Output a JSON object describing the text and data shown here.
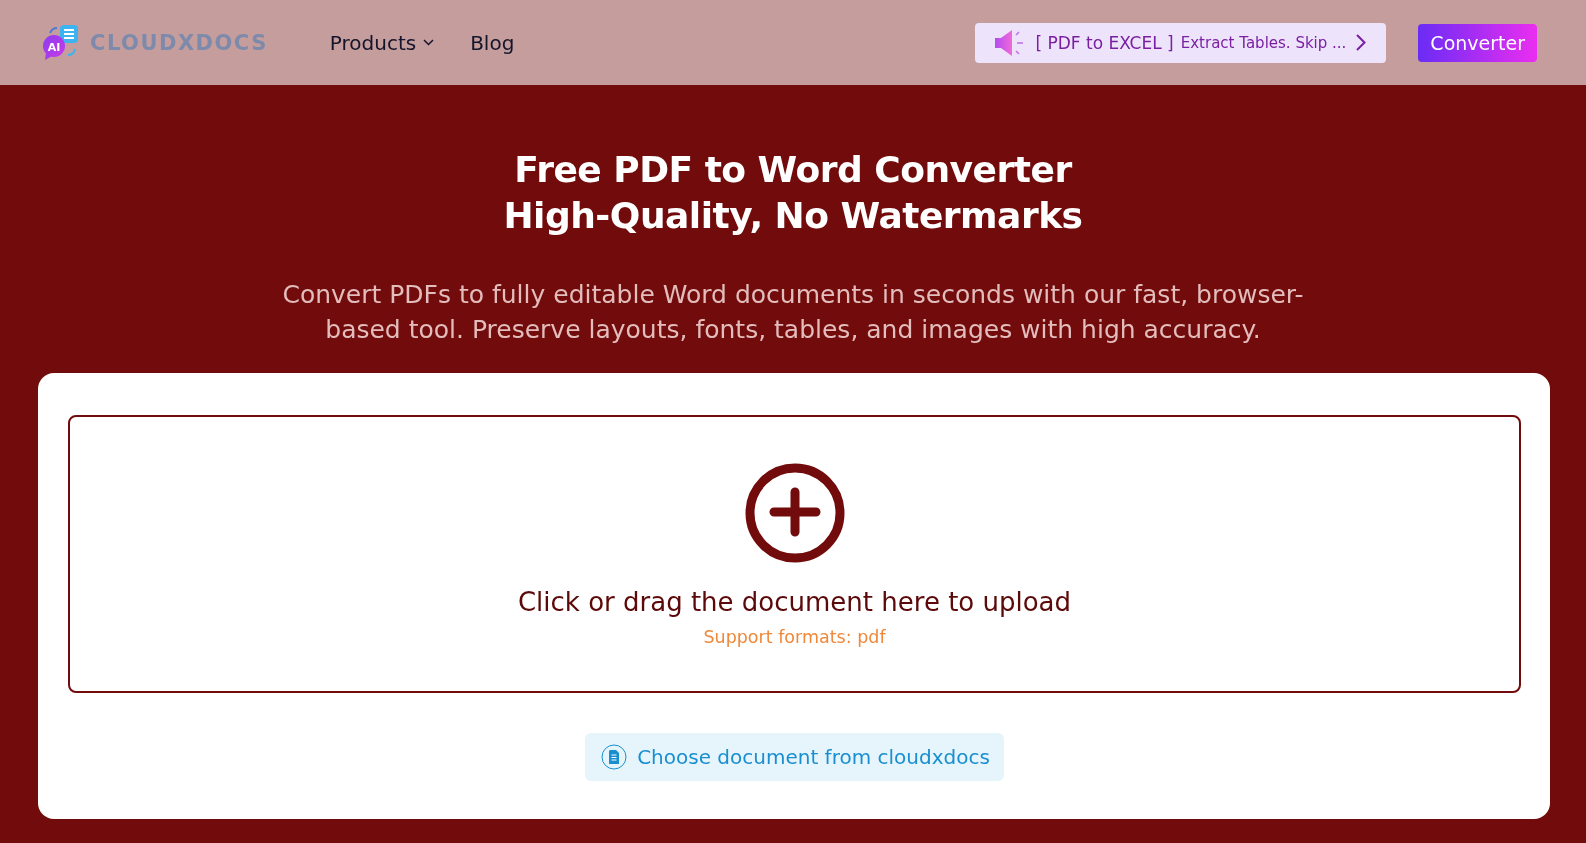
{
  "header": {
    "logo": {
      "badge": "AI",
      "name": "CLOUDXDOCS"
    },
    "nav": [
      {
        "label": "Products",
        "has_dropdown": true
      },
      {
        "label": "Blog",
        "has_dropdown": false
      }
    ],
    "announcement": {
      "tag": "[ PDF to EXCEL ]",
      "text": "Extract Tables. Skip ..."
    },
    "cta": "Converter"
  },
  "hero": {
    "title_lines": [
      "Free PDF to Word Converter",
      "High-Quality, No Watermarks"
    ],
    "subtitle": "Convert PDFs to fully editable Word documents in seconds with our fast, browser-based tool. Preserve layouts, fonts, tables, and images with high accuracy."
  },
  "upload": {
    "prompt": "Click or drag the document here to upload",
    "formats": "Support formats: pdf",
    "cloud_button": "Choose document from cloudxdocs"
  }
}
